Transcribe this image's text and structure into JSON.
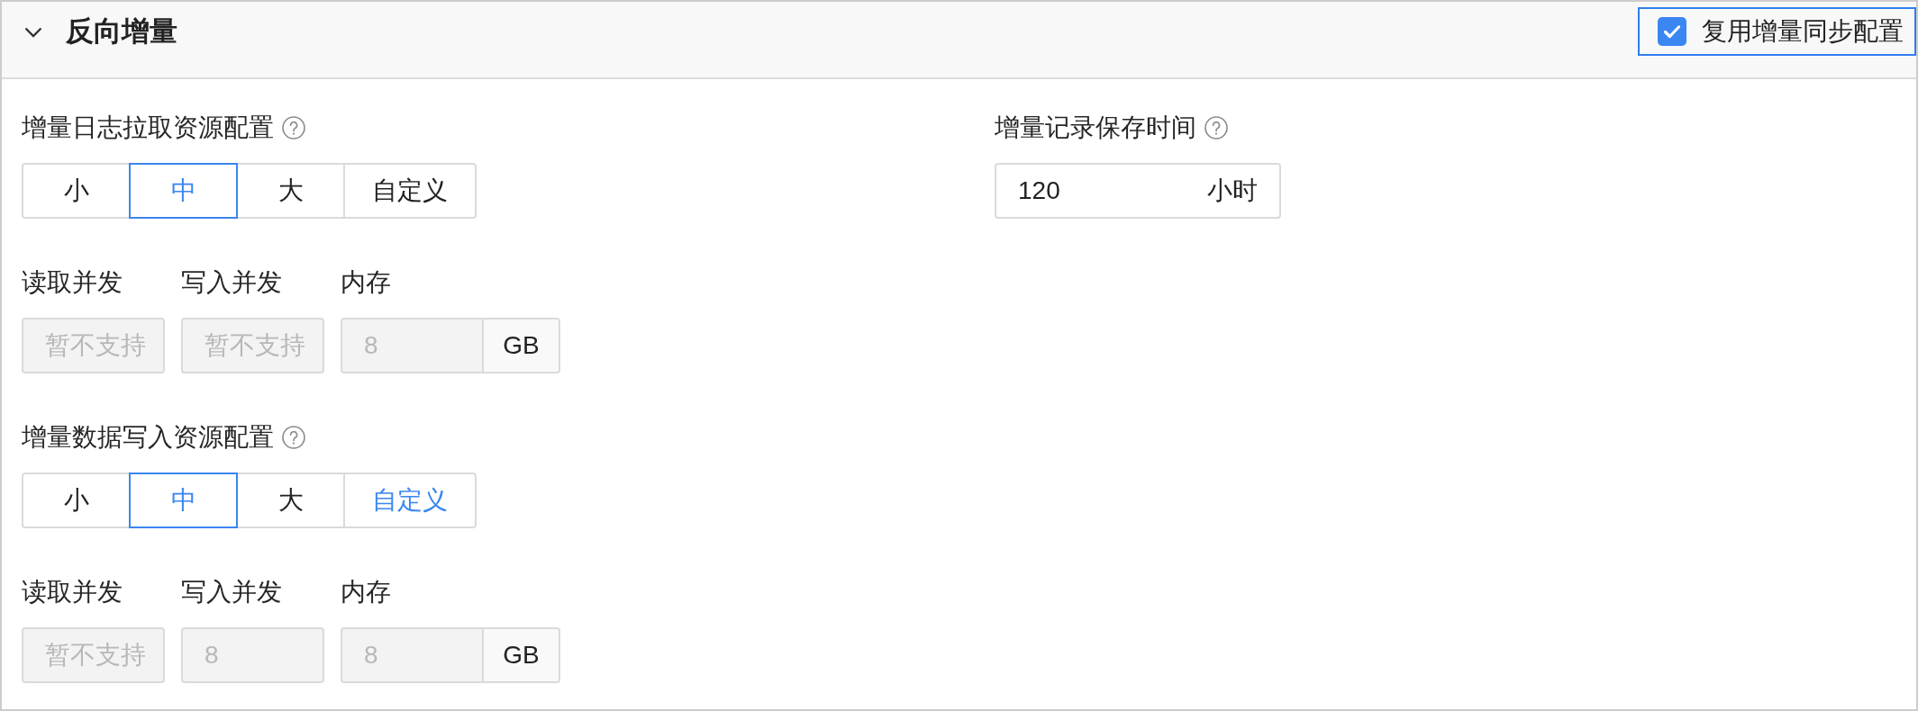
{
  "section": {
    "title": "反向增量",
    "expanded": true
  },
  "reuse_option": {
    "label": "复用增量同步配置",
    "checked": true,
    "focused": true
  },
  "resource_groups": [
    {
      "label": "增量日志拉取资源配置",
      "options": [
        {
          "label": "小",
          "selected": false,
          "hovered": false
        },
        {
          "label": "中",
          "selected": true,
          "hovered": false
        },
        {
          "label": "大",
          "selected": false,
          "hovered": false
        },
        {
          "label": "自定义",
          "selected": false,
          "hovered": false
        }
      ],
      "fields": [
        {
          "label": "读取并发",
          "placeholder": "暂不支持",
          "disabled": true
        },
        {
          "label": "写入并发",
          "placeholder": "暂不支持",
          "disabled": true
        },
        {
          "label": "内存",
          "value": "8",
          "unit": "GB",
          "disabled": true
        }
      ]
    },
    {
      "label": "增量数据写入资源配置",
      "options": [
        {
          "label": "小",
          "selected": false,
          "hovered": false
        },
        {
          "label": "中",
          "selected": true,
          "hovered": false
        },
        {
          "label": "大",
          "selected": false,
          "hovered": false
        },
        {
          "label": "自定义",
          "selected": false,
          "hovered": true
        }
      ],
      "fields": [
        {
          "label": "读取并发",
          "placeholder": "暂不支持",
          "disabled": true
        },
        {
          "label": "写入并发",
          "value": "8",
          "disabled": true
        },
        {
          "label": "内存",
          "value": "8",
          "unit": "GB",
          "disabled": true
        }
      ]
    }
  ],
  "retention": {
    "label": "增量记录保存时间",
    "value": "120",
    "suffix": "小时",
    "disabled": false
  }
}
